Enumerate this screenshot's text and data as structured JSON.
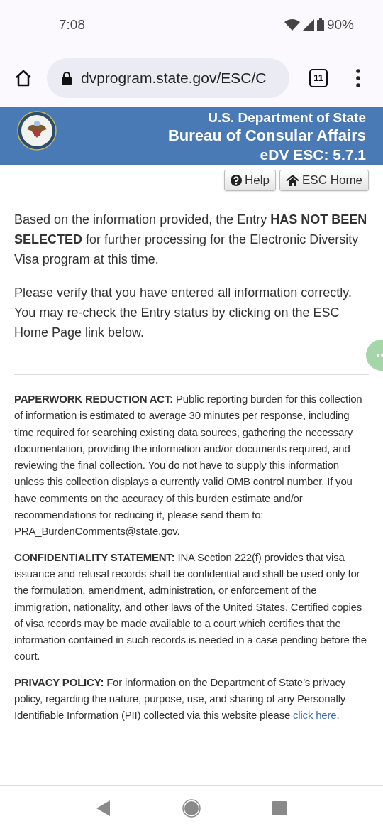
{
  "status_bar": {
    "time": "7:08",
    "battery": "90%"
  },
  "browser": {
    "url": "dvprogram.state.gov/ESC/C",
    "tab_count": "11"
  },
  "header": {
    "lines": [
      "U.S. Department of State",
      "Bureau of Consular Affairs",
      "eDV ESC: 5.7.1"
    ]
  },
  "buttons": [
    {
      "kind": "help",
      "label": "Help"
    },
    {
      "kind": "home",
      "label": "ESC Home"
    }
  ],
  "result": [
    "Based on the information provided, the Entry **HAS NOT BEEN SELECTED** for further processing for the Electronic Diversity Visa program at this time.",
    "Please verify that you have entered all information correctly. You may re-check the Entry status by clicking on the ESC Home Page link below."
  ],
  "notices": [
    {
      "text": "**PAPERWORK REDUCTION ACT:** Public reporting burden for this collection of information is estimated to average 30 minutes per response, including time required for searching existing data sources, gathering the necessary documentation, providing the information and/or documents required, and reviewing the final collection. You do not have to supply this information unless this collection displays a currently valid OMB control number. If you have comments on the accuracy of this burden estimate and/or recommendations for reducing it, please send them to: PRA_BurdenComments@state.gov."
    },
    {
      "text": "**CONFIDENTIALITY STATEMENT:** INA Section 222(f) provides that visa issuance and refusal records shall be confidential and shall be used only for the formulation, amendment, administration, or enforcement of the immigration, nationality, and other laws of the United States. Certified copies of visa records may be made available to a court which certifies that the information contained in such records is needed in a case pending before the court."
    },
    {
      "text": "**PRIVACY POLICY:** For information on the Department of State’s privacy policy, regarding the nature, purpose, use, and sharing of any Personally Identifiable Information (PII) collected via this website please",
      "link": "click here",
      "after": "."
    }
  ]
}
